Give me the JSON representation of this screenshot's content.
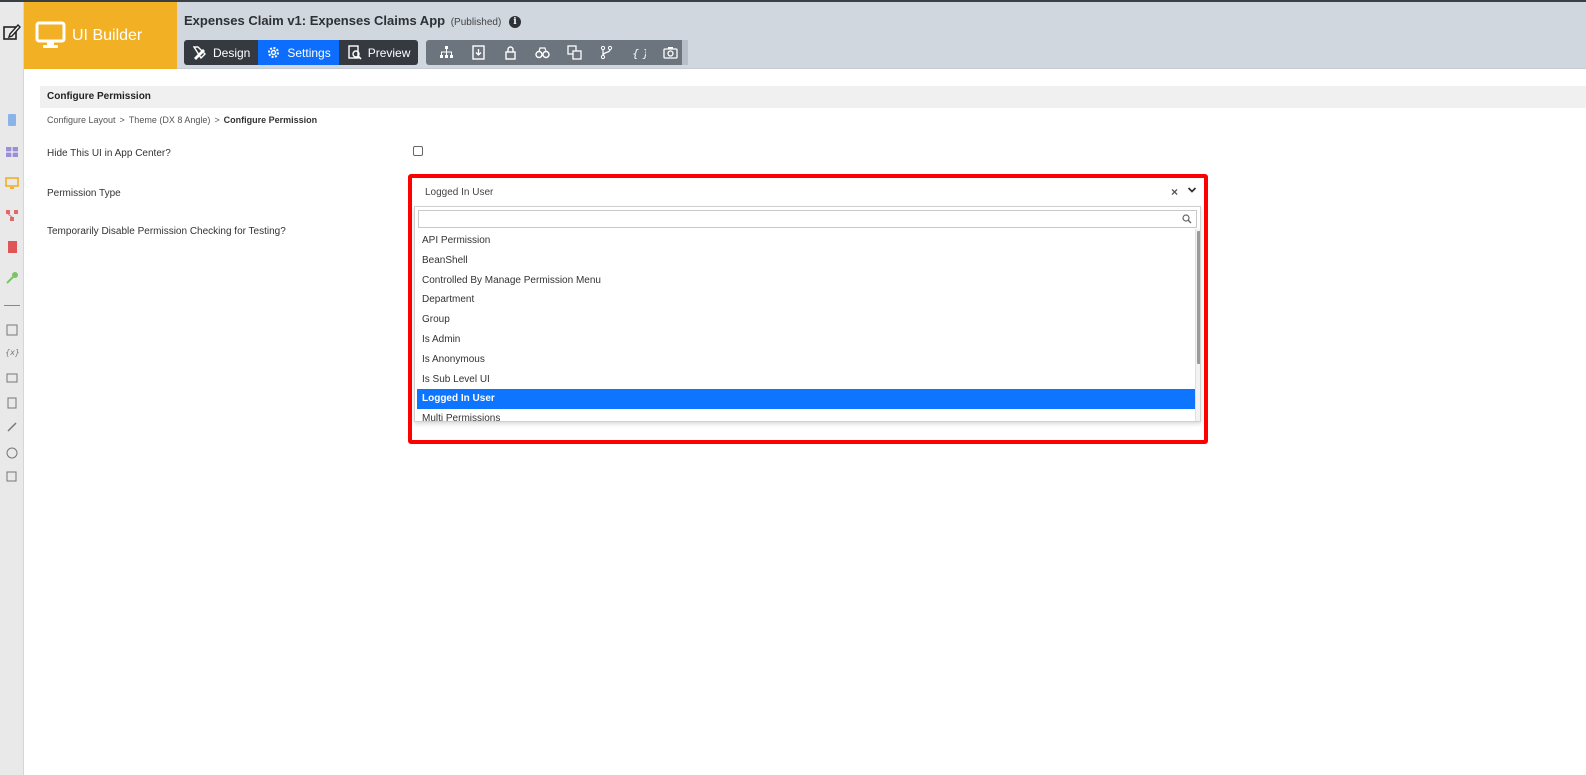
{
  "brand": {
    "title": "UI Builder"
  },
  "header": {
    "app_title": "Expenses Claim v1: Expenses Claims App",
    "status": "(Published)",
    "info_glyph": "i"
  },
  "modes": [
    {
      "label": "Design",
      "icon": "pencil-ruler-icon"
    },
    {
      "label": "Settings",
      "icon": "gear-icon",
      "active": true
    },
    {
      "label": "Preview",
      "icon": "preview-icon"
    }
  ],
  "tools": [
    "sitemap-icon",
    "import-icon",
    "lock-icon",
    "binoculars-icon",
    "translate-icon",
    "branch-icon",
    "code-braces-icon",
    "camera-icon"
  ],
  "section": {
    "title": "Configure Permission"
  },
  "breadcrumb": {
    "items": [
      "Configure Layout",
      "Theme (DX 8 Angle)",
      "Configure Permission"
    ],
    "separator": ">"
  },
  "form": {
    "hide_label": "Hide This UI in App Center?",
    "hide_checked": false,
    "permission_label": "Permission Type",
    "disable_label": "Temporarily Disable Permission Checking for Testing?"
  },
  "select": {
    "value": "Logged In User",
    "clear_glyph": "×",
    "search_value": "",
    "options": [
      "API Permission",
      "BeanShell",
      "Controlled By Manage Permission Menu",
      "Department",
      "Group",
      "Is Admin",
      "Is Anonymous",
      "Is Sub Level UI",
      "Logged In User",
      "Multi Permissions"
    ],
    "selected_index": 8
  },
  "colors": {
    "brand": "#f2b024",
    "header": "#d1d7de",
    "accent": "#0d6efd",
    "highlight": "#ff0000",
    "selected_option": "#0d75ff"
  }
}
